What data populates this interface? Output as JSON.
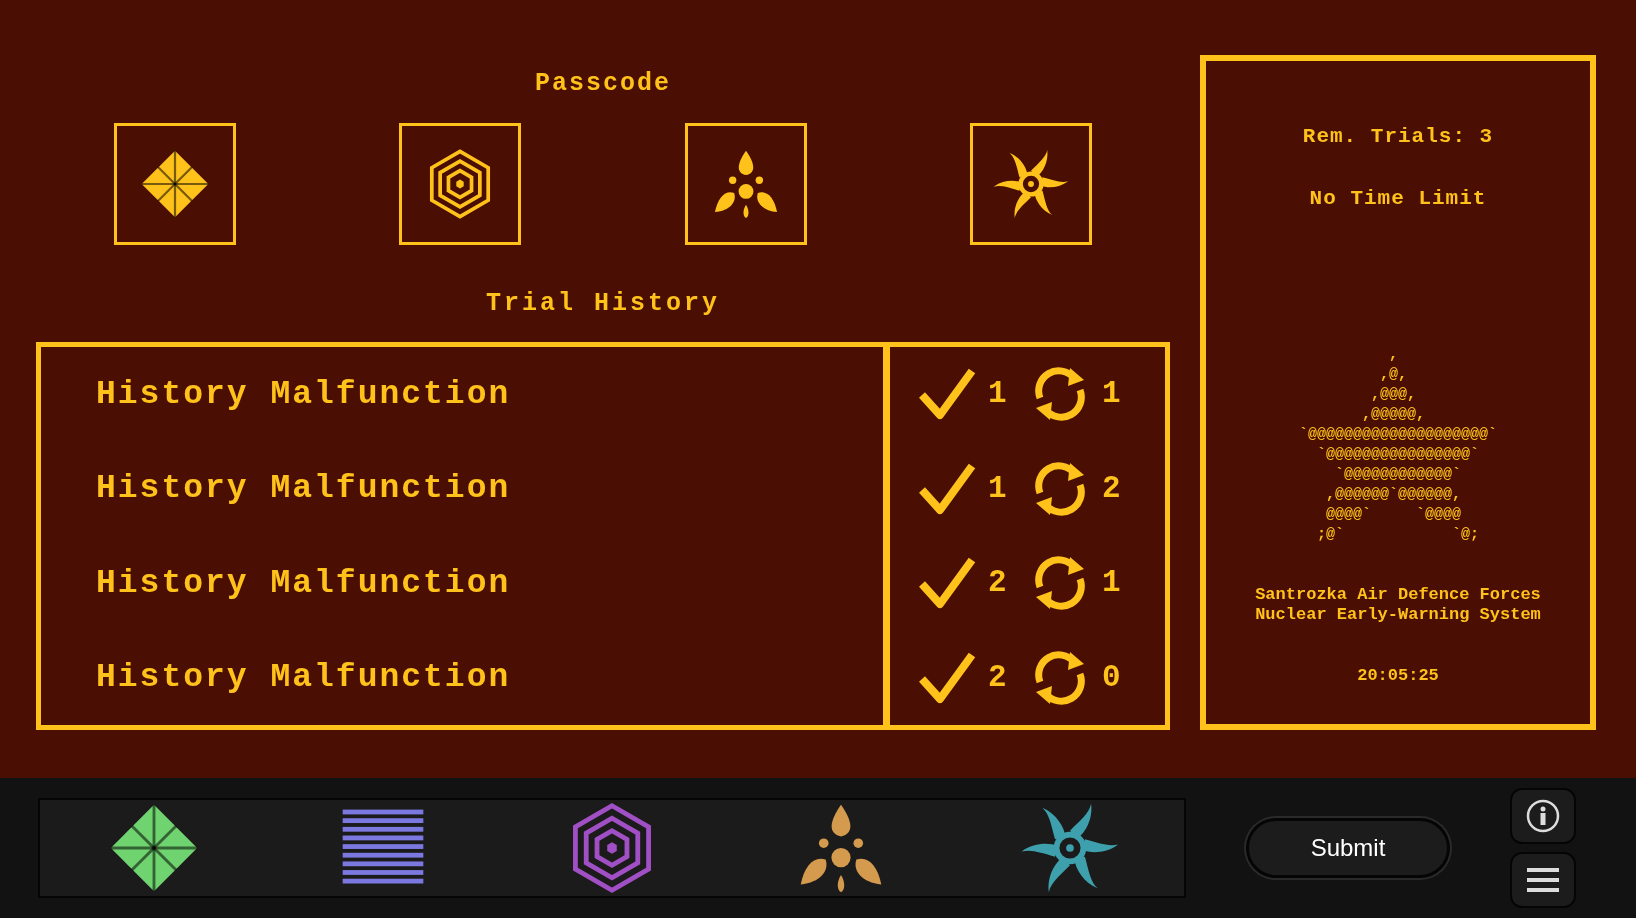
{
  "passcode": {
    "title": "Passcode",
    "symbols": [
      {
        "kind": "diamond"
      },
      {
        "kind": "hexagon"
      },
      {
        "kind": "trefoil"
      },
      {
        "kind": "swirl"
      }
    ]
  },
  "trial_history": {
    "title": "Trial History",
    "rows": [
      {
        "label": "History Malfunction",
        "correct": "1",
        "cycles": "1"
      },
      {
        "label": "History Malfunction",
        "correct": "1",
        "cycles": "2"
      },
      {
        "label": "History Malfunction",
        "correct": "2",
        "cycles": "1"
      },
      {
        "label": "History Malfunction",
        "correct": "2",
        "cycles": "0"
      }
    ]
  },
  "status_panel": {
    "trials": "Rem. Trials: 3",
    "time_limit": "No Time Limit",
    "emblem": [
      "          ,",
      "         ,@,",
      "        ,@@@,",
      "       ,@@@@@,",
      "`@@@@@@@@@@@@@@@@@@@@`",
      "  `@@@@@@@@@@@@@@@@`",
      "    `@@@@@@@@@@@@`",
      "   ,@@@@@@`@@@@@@,",
      "   @@@@`     `@@@@",
      "  ;@`            `@;"
    ],
    "organization": [
      "Santrozka Air Defence Forces",
      "Nuclear Early-Warning System"
    ],
    "clock": "20:05:25"
  },
  "symbol_palette": [
    {
      "kind": "diamond",
      "color": "#6fd46f"
    },
    {
      "kind": "stripes",
      "color": "#7b79e0"
    },
    {
      "kind": "hexagon",
      "color": "#a14fc4"
    },
    {
      "kind": "trefoil",
      "color": "#d49a4e"
    },
    {
      "kind": "swirl",
      "color": "#3fa0ad"
    }
  ],
  "submit_button": "Submit"
}
